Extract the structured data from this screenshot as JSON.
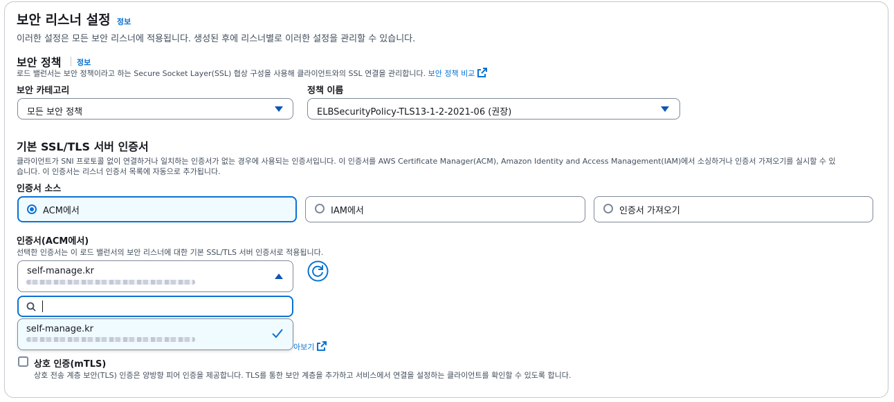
{
  "section": {
    "title": "보안 리스너 설정",
    "info": "정보",
    "description": "이러한 설정은 모든 보안 리스너에 적용됩니다. 생성된 후에 리스너별로 이러한 설정을 관리할 수 있습니다."
  },
  "security_policy": {
    "title": "보안 정책",
    "info": "정보",
    "description": "로드 밸런서는 보안 정책이라고 하는 Secure Socket Layer(SSL) 협상 구성을 사용해 클라이언트와의 SSL 연결을 관리합니다.",
    "compare_link": "보안 정책 비교",
    "category_label": "보안 카테고리",
    "category_value": "모든 보안 정책",
    "policy_label": "정책 이름",
    "policy_value": "ELBSecurityPolicy-TLS13-1-2-2021-06 (권장)"
  },
  "certificate": {
    "title": "기본 SSL/TLS 서버 인증서",
    "description_line1": "클라이언트가 SNI 프로토콜 없이 연결하거나 일치하는 인증서가 없는 경우에 사용되는 인증서입니다. 이 인증서를 AWS Certificate Manager(ACM), Amazon Identity and Access Management(IAM)에서 소싱하거나 인증서 가져오기를 실시할 수 있",
    "description_line2": "습니다. 이 인증서는 리스너 인증서 목록에 자동으로 추가됩니다.",
    "source_label": "인증서 소스",
    "sources": [
      {
        "label": "ACM에서",
        "selected": true
      },
      {
        "label": "IAM에서",
        "selected": false
      },
      {
        "label": "인증서 가져오기",
        "selected": false
      }
    ],
    "acm_label": "인증서(ACM에서)",
    "acm_description": "선택한 인증서는 이 로드 밸런서의 보안 리스너에 대한 기본 SSL/TLS 서버 인증서로 적용됩니다.",
    "selected_cert": "self-manage.kr",
    "search_value": "",
    "options": [
      {
        "label": "self-manage.kr",
        "selected": true
      }
    ],
    "partial_link": "아보기"
  },
  "mtls": {
    "label": "상호 인증(mTLS)",
    "checked": false,
    "description": "상호 전송 계층 보안(TLS) 인증은 양방향 피어 인증을 제공합니다. TLS를 통한 보안 계층을 추가하고 서비스에서 연결을 설정하는 클라이언트를 확인할 수 있도록 합니다."
  },
  "colors": {
    "accent": "#0972d3",
    "border": "#7d8998",
    "text": "#16191f"
  }
}
